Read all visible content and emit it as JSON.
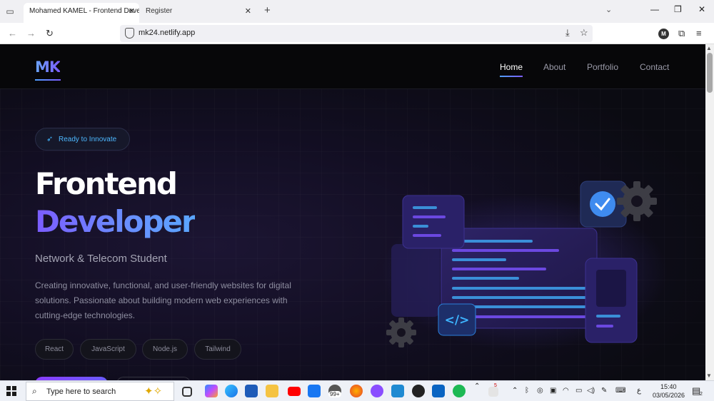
{
  "browser": {
    "tabs": [
      {
        "title": "Mohamed KAMEL - Frontend Devel",
        "active": true
      },
      {
        "title": "Register",
        "active": false
      }
    ],
    "new_tab": "+",
    "url": "mk24.netlify.app",
    "profile_initial": "M"
  },
  "site": {
    "logo": "MK",
    "nav": [
      {
        "label": "Home",
        "active": true
      },
      {
        "label": "About",
        "active": false
      },
      {
        "label": "Portfolio",
        "active": false
      },
      {
        "label": "Contact",
        "active": false
      }
    ],
    "badge": "Ready to Innovate",
    "hero": {
      "line1": "Frontend",
      "line2": "Developer",
      "subtitle": "Network & Telecom Student",
      "description": "Creating innovative, functional, and user-friendly websites for digital solutions. Passionate about building modern web experiences with cutting-edge technologies."
    },
    "tech_tags": [
      "React",
      "JavaScript",
      "Node.js",
      "Tailwind"
    ],
    "code_symbol": "</>",
    "colors": {
      "accent_blue": "#4fa0ff",
      "accent_purple": "#7b5cff",
      "bg": "#0b0b12"
    }
  },
  "taskbar": {
    "search_placeholder": "Type here to search",
    "mail_badge": "99+",
    "tray_badge": "5",
    "keyboard_label": "ع",
    "time": "15:40",
    "date": "03/05/2026",
    "notification_count": "2"
  }
}
